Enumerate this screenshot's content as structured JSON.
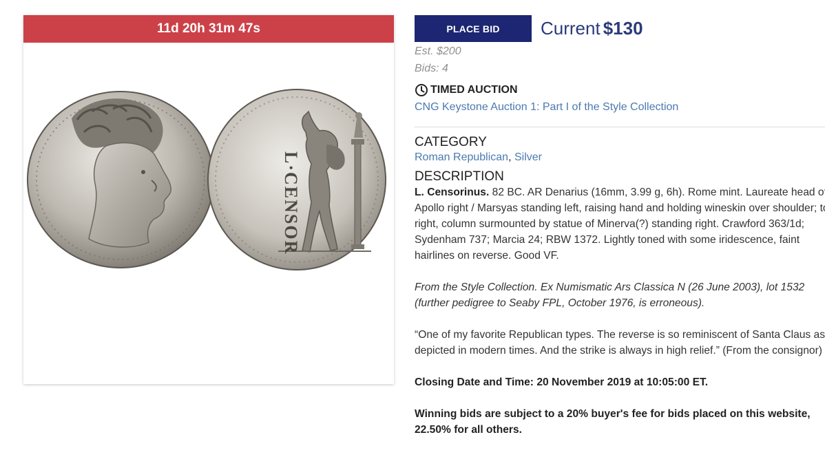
{
  "timer": "11d 20h 31m 47s",
  "bid": {
    "button_label": "PLACE BID",
    "current_label": "Current",
    "current_amount": "$130",
    "estimate": "Est. $200",
    "bids": "Bids: 4"
  },
  "auction": {
    "type_label": "TIMED AUCTION",
    "name": "CNG Keystone Auction 1: Part I of the Style Collection"
  },
  "category": {
    "heading": "CATEGORY",
    "links": [
      "Roman Republican",
      "Silver"
    ],
    "separator": ", "
  },
  "description": {
    "heading": "DESCRIPTION",
    "issuer": "L. Censorinus.",
    "main_text": " 82 BC. AR Denarius (16mm, 3.99 g, 6h). Rome mint. Laureate head of Apollo right / Marsyas standing left, raising hand and holding wineskin over shoulder; to right, column surmounted by statue of Minerva(?) standing right. Crawford 363/1d; Sydenham 737; Marcia 24; RBW 1372. Lightly toned with some iridescence, faint hairlines on reverse. Good VF.",
    "provenance": "From the Style Collection. Ex Numismatic Ars Classica N (26 June 2003), lot 1532 (further pedigree to Seaby FPL, October 1976, is erroneous).",
    "quote": "“One of my favorite Republican types. The reverse is so reminiscent of Santa Claus as depicted in modern times. And the strike is always in high relief.” (From the consignor)",
    "closing": "Closing Date and Time: 20 November 2019 at 10:05:00 ET.",
    "fee_note": "Winning bids are subject to a 20% buyer's fee for bids placed on this website, 22.50% for all others."
  },
  "coin_legend": "L·CENSOR"
}
